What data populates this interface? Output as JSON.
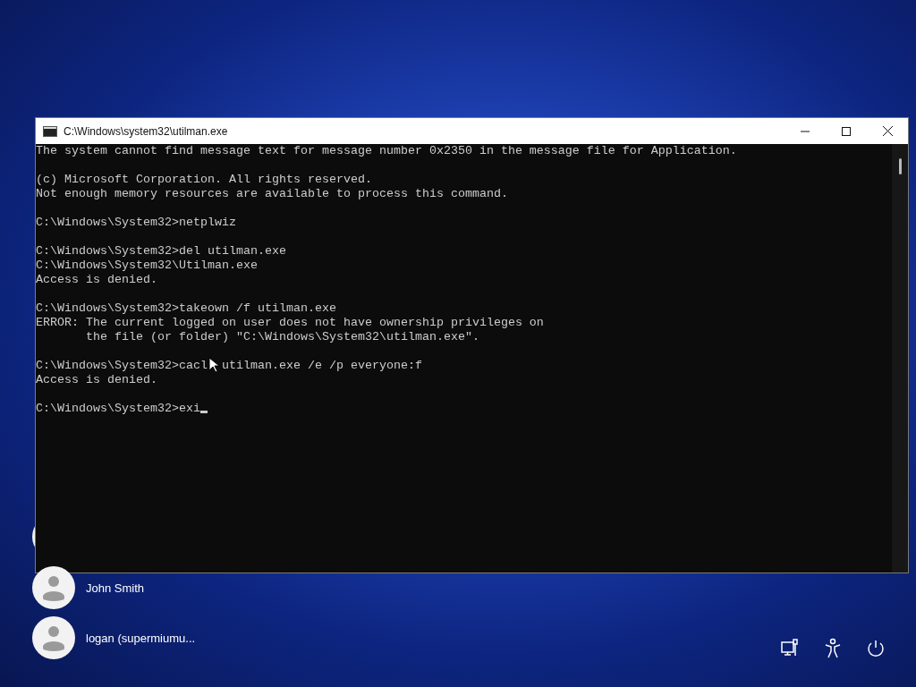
{
  "console_window": {
    "title": "C:\\Windows\\system32\\utilman.exe",
    "output_blocks": [
      [
        "The system cannot find message text for message number 0x2350 in the message file for Application."
      ],
      [
        "(c) Microsoft Corporation. All rights reserved.",
        "Not enough memory resources are available to process this command."
      ],
      [
        "C:\\Windows\\System32>netplwiz"
      ],
      [
        "C:\\Windows\\System32>del utilman.exe",
        "C:\\Windows\\System32\\Utilman.exe",
        "Access is denied."
      ],
      [
        "C:\\Windows\\System32>takeown /f utilman.exe",
        "ERROR: The current logged on user does not have ownership privileges on",
        "       the file (or folder) \"C:\\Windows\\System32\\utilman.exe\"."
      ],
      [
        [
          "C:\\Windows\\System32>cacl",
          "utilman.exe /e /p everyone:f"
        ],
        "Access is denied."
      ]
    ],
    "input_line": "C:\\Windows\\System32>exi"
  },
  "users": [
    {
      "name": "John Smith"
    },
    {
      "name": "logan (supermiumu..."
    }
  ]
}
